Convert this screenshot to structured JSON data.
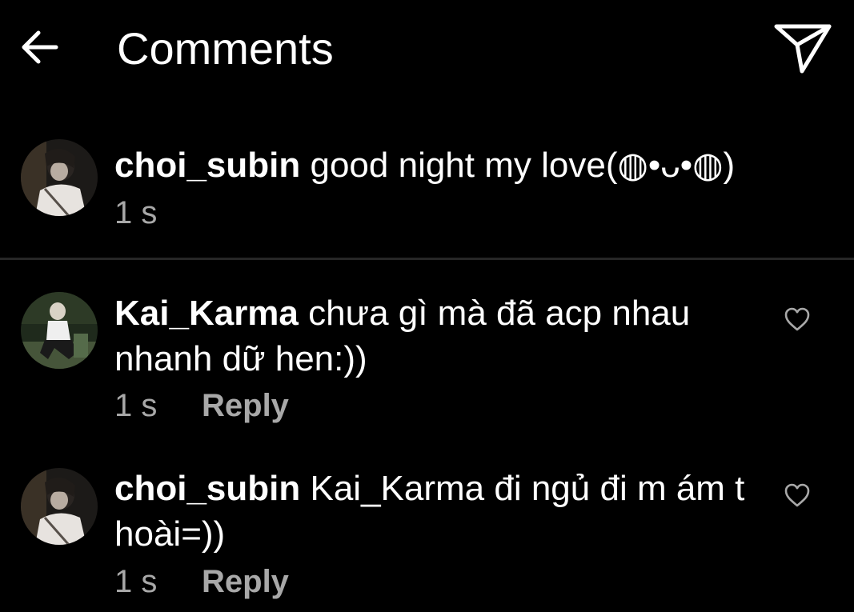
{
  "header": {
    "title": "Comments",
    "back_icon": "arrow-left-icon",
    "send_icon": "paper-plane-icon"
  },
  "caption": {
    "username": "choi_subin",
    "text": "good night my love(◍•ᴗ•◍)",
    "time": "1 s"
  },
  "comments": [
    {
      "username": "Kai_Karma",
      "text": "chưa gì mà đã acp nhau nhanh dữ hen:))",
      "time": "1 s",
      "reply_label": "Reply",
      "like_icon": "heart-outline-icon"
    },
    {
      "username": "choi_subin",
      "text": "Kai_Karma đi ngủ đi m ám t hoài=))",
      "time": "1 s",
      "reply_label": "Reply",
      "like_icon": "heart-outline-icon"
    }
  ],
  "colors": {
    "background": "#000000",
    "text": "#ffffff",
    "secondary_text": "#a8a8a8",
    "divider": "#262626"
  }
}
